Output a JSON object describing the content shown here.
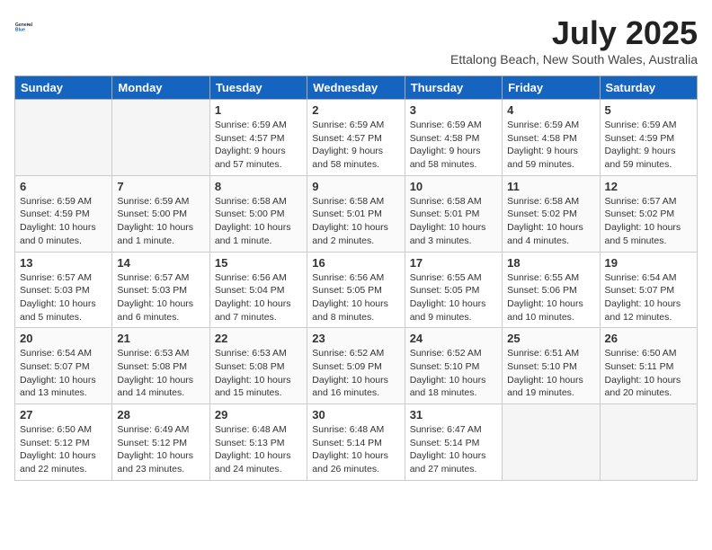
{
  "header": {
    "logo_general": "General",
    "logo_blue": "Blue",
    "month_year": "July 2025",
    "location": "Ettalong Beach, New South Wales, Australia"
  },
  "days_of_week": [
    "Sunday",
    "Monday",
    "Tuesday",
    "Wednesday",
    "Thursday",
    "Friday",
    "Saturday"
  ],
  "weeks": [
    [
      {
        "day": "",
        "empty": true
      },
      {
        "day": "",
        "empty": true
      },
      {
        "day": "1",
        "sunrise": "6:59 AM",
        "sunset": "4:57 PM",
        "daylight": "9 hours and 57 minutes."
      },
      {
        "day": "2",
        "sunrise": "6:59 AM",
        "sunset": "4:57 PM",
        "daylight": "9 hours and 58 minutes."
      },
      {
        "day": "3",
        "sunrise": "6:59 AM",
        "sunset": "4:58 PM",
        "daylight": "9 hours and 58 minutes."
      },
      {
        "day": "4",
        "sunrise": "6:59 AM",
        "sunset": "4:58 PM",
        "daylight": "9 hours and 59 minutes."
      },
      {
        "day": "5",
        "sunrise": "6:59 AM",
        "sunset": "4:59 PM",
        "daylight": "9 hours and 59 minutes."
      }
    ],
    [
      {
        "day": "6",
        "sunrise": "6:59 AM",
        "sunset": "4:59 PM",
        "daylight": "10 hours and 0 minutes."
      },
      {
        "day": "7",
        "sunrise": "6:59 AM",
        "sunset": "5:00 PM",
        "daylight": "10 hours and 1 minute."
      },
      {
        "day": "8",
        "sunrise": "6:58 AM",
        "sunset": "5:00 PM",
        "daylight": "10 hours and 1 minute."
      },
      {
        "day": "9",
        "sunrise": "6:58 AM",
        "sunset": "5:01 PM",
        "daylight": "10 hours and 2 minutes."
      },
      {
        "day": "10",
        "sunrise": "6:58 AM",
        "sunset": "5:01 PM",
        "daylight": "10 hours and 3 minutes."
      },
      {
        "day": "11",
        "sunrise": "6:58 AM",
        "sunset": "5:02 PM",
        "daylight": "10 hours and 4 minutes."
      },
      {
        "day": "12",
        "sunrise": "6:57 AM",
        "sunset": "5:02 PM",
        "daylight": "10 hours and 5 minutes."
      }
    ],
    [
      {
        "day": "13",
        "sunrise": "6:57 AM",
        "sunset": "5:03 PM",
        "daylight": "10 hours and 5 minutes."
      },
      {
        "day": "14",
        "sunrise": "6:57 AM",
        "sunset": "5:03 PM",
        "daylight": "10 hours and 6 minutes."
      },
      {
        "day": "15",
        "sunrise": "6:56 AM",
        "sunset": "5:04 PM",
        "daylight": "10 hours and 7 minutes."
      },
      {
        "day": "16",
        "sunrise": "6:56 AM",
        "sunset": "5:05 PM",
        "daylight": "10 hours and 8 minutes."
      },
      {
        "day": "17",
        "sunrise": "6:55 AM",
        "sunset": "5:05 PM",
        "daylight": "10 hours and 9 minutes."
      },
      {
        "day": "18",
        "sunrise": "6:55 AM",
        "sunset": "5:06 PM",
        "daylight": "10 hours and 10 minutes."
      },
      {
        "day": "19",
        "sunrise": "6:54 AM",
        "sunset": "5:07 PM",
        "daylight": "10 hours and 12 minutes."
      }
    ],
    [
      {
        "day": "20",
        "sunrise": "6:54 AM",
        "sunset": "5:07 PM",
        "daylight": "10 hours and 13 minutes."
      },
      {
        "day": "21",
        "sunrise": "6:53 AM",
        "sunset": "5:08 PM",
        "daylight": "10 hours and 14 minutes."
      },
      {
        "day": "22",
        "sunrise": "6:53 AM",
        "sunset": "5:08 PM",
        "daylight": "10 hours and 15 minutes."
      },
      {
        "day": "23",
        "sunrise": "6:52 AM",
        "sunset": "5:09 PM",
        "daylight": "10 hours and 16 minutes."
      },
      {
        "day": "24",
        "sunrise": "6:52 AM",
        "sunset": "5:10 PM",
        "daylight": "10 hours and 18 minutes."
      },
      {
        "day": "25",
        "sunrise": "6:51 AM",
        "sunset": "5:10 PM",
        "daylight": "10 hours and 19 minutes."
      },
      {
        "day": "26",
        "sunrise": "6:50 AM",
        "sunset": "5:11 PM",
        "daylight": "10 hours and 20 minutes."
      }
    ],
    [
      {
        "day": "27",
        "sunrise": "6:50 AM",
        "sunset": "5:12 PM",
        "daylight": "10 hours and 22 minutes."
      },
      {
        "day": "28",
        "sunrise": "6:49 AM",
        "sunset": "5:12 PM",
        "daylight": "10 hours and 23 minutes."
      },
      {
        "day": "29",
        "sunrise": "6:48 AM",
        "sunset": "5:13 PM",
        "daylight": "10 hours and 24 minutes."
      },
      {
        "day": "30",
        "sunrise": "6:48 AM",
        "sunset": "5:14 PM",
        "daylight": "10 hours and 26 minutes."
      },
      {
        "day": "31",
        "sunrise": "6:47 AM",
        "sunset": "5:14 PM",
        "daylight": "10 hours and 27 minutes."
      },
      {
        "day": "",
        "empty": true
      },
      {
        "day": "",
        "empty": true
      }
    ]
  ]
}
